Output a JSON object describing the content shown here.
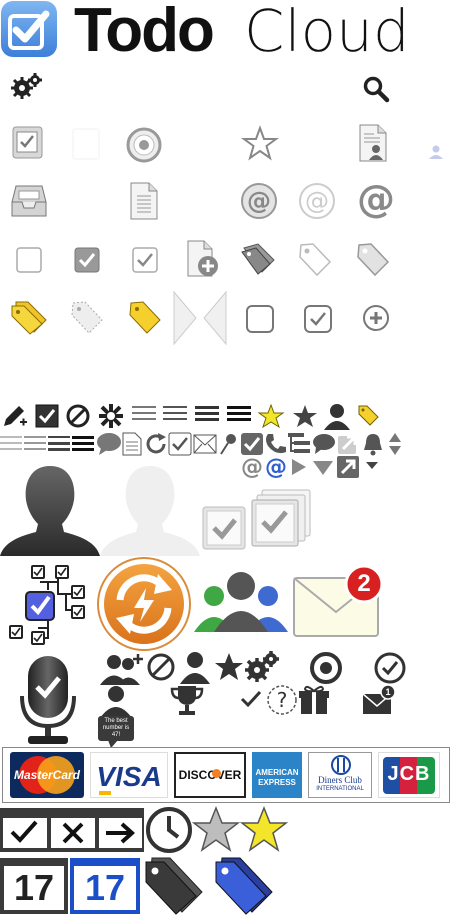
{
  "brand": {
    "word1": "Todo",
    "word2": "Cloud"
  },
  "bubble": {
    "text": "The best number is 47!"
  },
  "badges": {
    "mail_count": "2",
    "small_mail_count": "1"
  },
  "help_symbol": "?",
  "payment_cards": {
    "mastercard": "MasterCard",
    "visa": "VISA",
    "discover": "DISCOVER",
    "amex_line1": "AMERICAN",
    "amex_line2": "EXPRESS",
    "diners_line1": "Diners Club",
    "diners_line2": "INTERNATIONAL",
    "jcb": "JCB"
  },
  "calendar": {
    "day_gray": "17",
    "day_blue": "17"
  },
  "colors": {
    "app_blue": "#4a8fe0",
    "sync_orange": "#e88a2c",
    "badge_red": "#d92020",
    "star_yellow": "#f3e52a",
    "tag_yellow": "#f5cf2c",
    "tag_blue": "#3a5fd8",
    "check_gray": "#8b8b8b"
  },
  "icons": [
    "app-logo-icon",
    "gear-icon",
    "search-icon",
    "checkbox-tile-icon",
    "target-icon",
    "star-outline-icon",
    "contact-card-icon",
    "person-icon",
    "inbox-tray-icon",
    "document-icon",
    "at-sign-icon",
    "checkbox-icon",
    "add-document-icon",
    "tags-icon",
    "tag-icon",
    "collapse-arrows-icon",
    "add-circle-icon",
    "pencil-icon",
    "block-icon",
    "asterisk-icon",
    "menu-lines-icon",
    "bell-icon",
    "sort-arrows-icon",
    "comment-icon",
    "refresh-icon",
    "mail-icon",
    "phone-icon",
    "tree-list-icon",
    "play-icon",
    "triangle-down-icon",
    "arrow-out-icon",
    "person-silhouette-icon",
    "stacked-checkbox-icon",
    "checklist-tree-icon",
    "sync-icon",
    "group-icon",
    "mail-badge-icon",
    "microphone-check-icon",
    "add-person-icon",
    "trophy-icon",
    "question-icon",
    "gift-icon",
    "calendar-icon",
    "clock-icon",
    "star-filled-icon"
  ]
}
